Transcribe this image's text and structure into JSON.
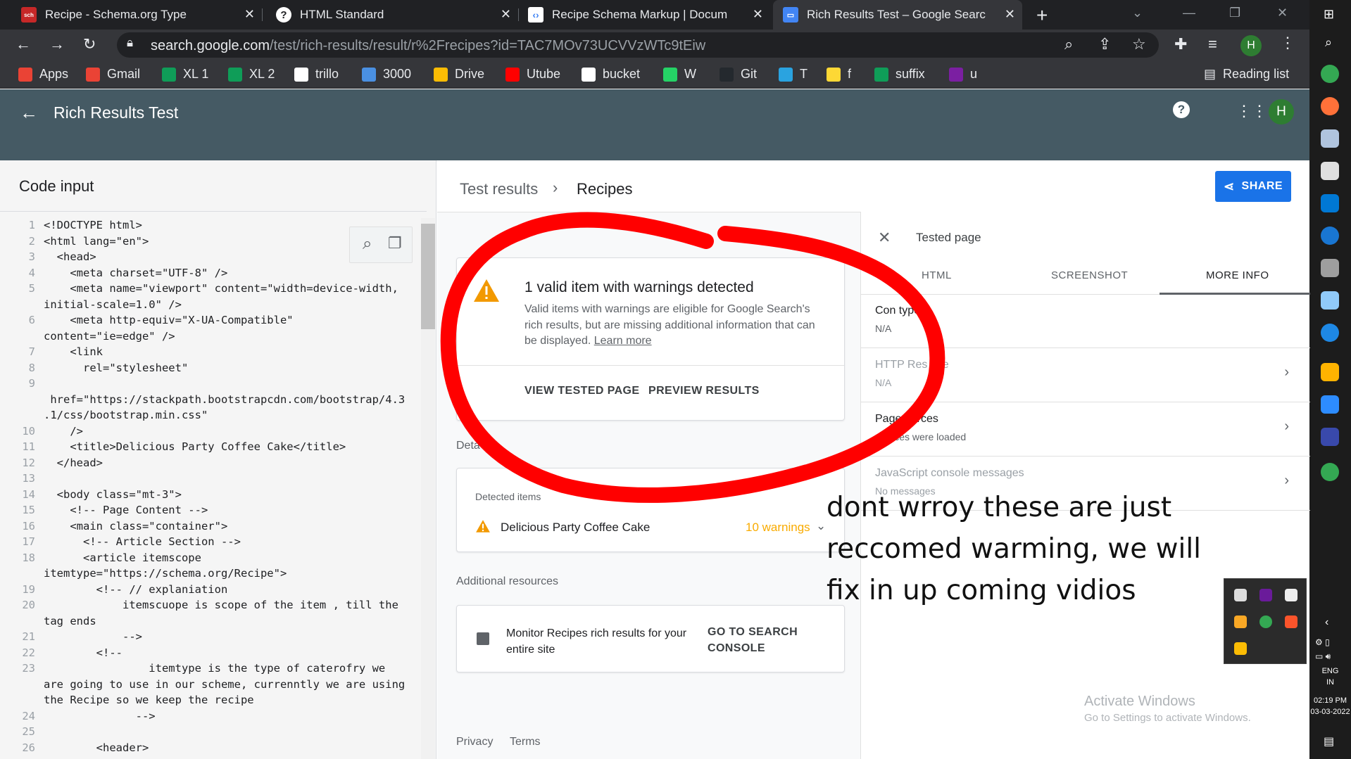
{
  "browser": {
    "tabs": [
      {
        "title": "Recipe - Schema.org Type",
        "icon": "schema-org-icon",
        "icon_color": "#c62828"
      },
      {
        "title": "HTML Standard",
        "icon": "whatwg-icon",
        "icon_color": "#ffffff"
      },
      {
        "title": "Recipe Schema Markup | Docum",
        "icon": "google-developers-icon",
        "icon_color": "#ffffff"
      },
      {
        "title": "Rich Results Test – Google Searc",
        "icon": "rich-results-icon",
        "icon_color": "#4285f4"
      }
    ],
    "url_host": "search.google.com",
    "url_path": "/test/rich-results/result/r%2Frecipes?id=TAC7MOv73UCVVzWTc9tEiw",
    "profile_initial": "H",
    "bookmarks": [
      {
        "label": "Apps",
        "icon": "apps-grid-icon",
        "color": "#ea4335"
      },
      {
        "label": "Gmail",
        "icon": "gmail-icon",
        "color": "#ea4335"
      },
      {
        "label": "XL 1",
        "icon": "sheets-icon",
        "color": "#0f9d58"
      },
      {
        "label": "XL 2",
        "icon": "sheets-icon",
        "color": "#0f9d58"
      },
      {
        "label": "trillo",
        "icon": "trillo-icon",
        "color": "#ffffff"
      },
      {
        "label": "3000",
        "icon": "localhost-icon",
        "color": "#4a90e2"
      },
      {
        "label": "Drive",
        "icon": "drive-icon",
        "color": "#fbbc04"
      },
      {
        "label": "Utube",
        "icon": "youtube-icon",
        "color": "#ff0000"
      },
      {
        "label": "bucket",
        "icon": "globe-icon",
        "color": "#ffffff"
      },
      {
        "label": "W",
        "icon": "whatsapp-icon",
        "color": "#25d366"
      },
      {
        "label": "Git",
        "icon": "github-icon",
        "color": "#24292e"
      },
      {
        "label": "T",
        "icon": "telegram-icon",
        "color": "#2aa3e0"
      },
      {
        "label": "f",
        "icon": "folder-icon",
        "color": "#fdd835"
      },
      {
        "label": "suffix",
        "icon": "sheets-icon",
        "color": "#0f9d58"
      },
      {
        "label": "u",
        "icon": "u-icon",
        "color": "#7b1fa2"
      }
    ],
    "reading_list": "Reading list"
  },
  "app": {
    "title": "Rich Results Test",
    "help": "?",
    "avatar": "H"
  },
  "code": {
    "header": "Code input",
    "lines": [
      {
        "n": "1",
        "t": "<!DOCTYPE html>"
      },
      {
        "n": "2",
        "t": "<html lang=\"en\">"
      },
      {
        "n": "3",
        "t": "  <head>"
      },
      {
        "n": "4",
        "t": "    <meta charset=\"UTF-8\" />"
      },
      {
        "n": "5",
        "t": "    <meta name=\"viewport\" content=\"width=device-width,"
      },
      {
        "n": "",
        "t": "initial-scale=1.0\" />"
      },
      {
        "n": "6",
        "t": "    <meta http-equiv=\"X-UA-Compatible\""
      },
      {
        "n": "",
        "t": "content=\"ie=edge\" />"
      },
      {
        "n": "7",
        "t": "    <link"
      },
      {
        "n": "8",
        "t": "      rel=\"stylesheet\""
      },
      {
        "n": "9",
        "t": ""
      },
      {
        "n": "",
        "t": " href=\"https://stackpath.bootstrapcdn.com/bootstrap/4.3"
      },
      {
        "n": "",
        "t": ".1/css/bootstrap.min.css\""
      },
      {
        "n": "10",
        "t": "    />"
      },
      {
        "n": "11",
        "t": "    <title>Delicious Party Coffee Cake</title>"
      },
      {
        "n": "12",
        "t": "  </head>"
      },
      {
        "n": "13",
        "t": ""
      },
      {
        "n": "14",
        "t": "  <body class=\"mt-3\">"
      },
      {
        "n": "15",
        "t": "    <!-- Page Content -->"
      },
      {
        "n": "16",
        "t": "    <main class=\"container\">"
      },
      {
        "n": "17",
        "t": "      <!-- Article Section -->"
      },
      {
        "n": "18",
        "t": "      <article itemscope"
      },
      {
        "n": "",
        "t": "itemtype=\"https://schema.org/Recipe\">"
      },
      {
        "n": "19",
        "t": "        <!-- // explaniation"
      },
      {
        "n": "20",
        "t": "            itemscuope is scope of the item , till the"
      },
      {
        "n": "",
        "t": "tag ends"
      },
      {
        "n": "21",
        "t": "            -->"
      },
      {
        "n": "22",
        "t": "        <!--"
      },
      {
        "n": "23",
        "t": "                itemtype is the type of caterofry we"
      },
      {
        "n": "",
        "t": "are going to use in our scheme, currenntly we are using"
      },
      {
        "n": "",
        "t": "the Recipe so we keep the recipe"
      },
      {
        "n": "24",
        "t": "              -->"
      },
      {
        "n": "25",
        "t": ""
      },
      {
        "n": "26",
        "t": "        <header>"
      }
    ]
  },
  "results": {
    "crumb_root": "Test results",
    "crumb_current": "Recipes",
    "share": "SHARE",
    "summary_title": "1 valid item with warnings detected",
    "summary_desc": "Valid items with warnings are eligible for Google Search's rich results, but are missing additional information that can be displayed.",
    "learn_more": "Learn more",
    "view_tested_page": "VIEW TESTED PAGE",
    "preview_results": "PREVIEW RESULTS",
    "details_label": "Deta",
    "detected_items_label": "Detected items",
    "item_name": "Delicious Party Coffee Cake",
    "warnings": "10 warnings",
    "additional_resources": "Additional resources",
    "monitor_text": "Monitor Recipes rich results for your entire site",
    "go_to_console": "GO TO SEARCH CONSOLE",
    "privacy": "Privacy",
    "terms": "Terms"
  },
  "tested_page": {
    "title": "Tested page",
    "tabs": [
      "HTML",
      "SCREENSHOT",
      "MORE INFO"
    ],
    "rows": [
      {
        "title": "Con      type",
        "sub": "N/A",
        "dim": false,
        "chevron": false
      },
      {
        "title": "HTTP Res        nse",
        "sub": "N/A",
        "dim": true,
        "chevron": true
      },
      {
        "title": "Page         ources",
        "sub": "     sources were loaded",
        "dim": false,
        "chevron": true
      },
      {
        "title": "JavaScript console messages",
        "sub": "No messages",
        "dim": true,
        "chevron": true
      }
    ]
  },
  "annotation": {
    "note": "dont wrroy these are just reccomed warming, we will fix in up coming vidios",
    "circle_color": "#ff0000"
  },
  "system": {
    "activate_title": "Activate Windows",
    "activate_sub": "Go to Settings to activate Windows.",
    "lang": "ENG",
    "region": "IN",
    "time": "02:19 PM",
    "date": "03-03-2022"
  }
}
